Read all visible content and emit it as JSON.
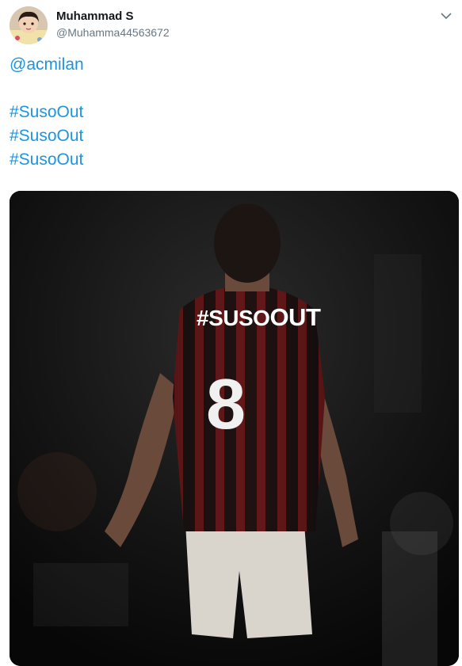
{
  "tweet": {
    "author_name": "Muhammad S",
    "author_handle": "@Muhamma44563672",
    "lines": [
      "@acmilan",
      "#SusoOut",
      "#SusoOut",
      "#SusoOut"
    ]
  },
  "media": {
    "overlay_hashtag": "#SUSO",
    "overlay_out": "OUT",
    "shirt_number": "8"
  },
  "icons": {
    "caret": "chevron-down-icon"
  },
  "colors": {
    "link": "#1b95e0",
    "name": "#14171a",
    "handle": "#657786"
  }
}
